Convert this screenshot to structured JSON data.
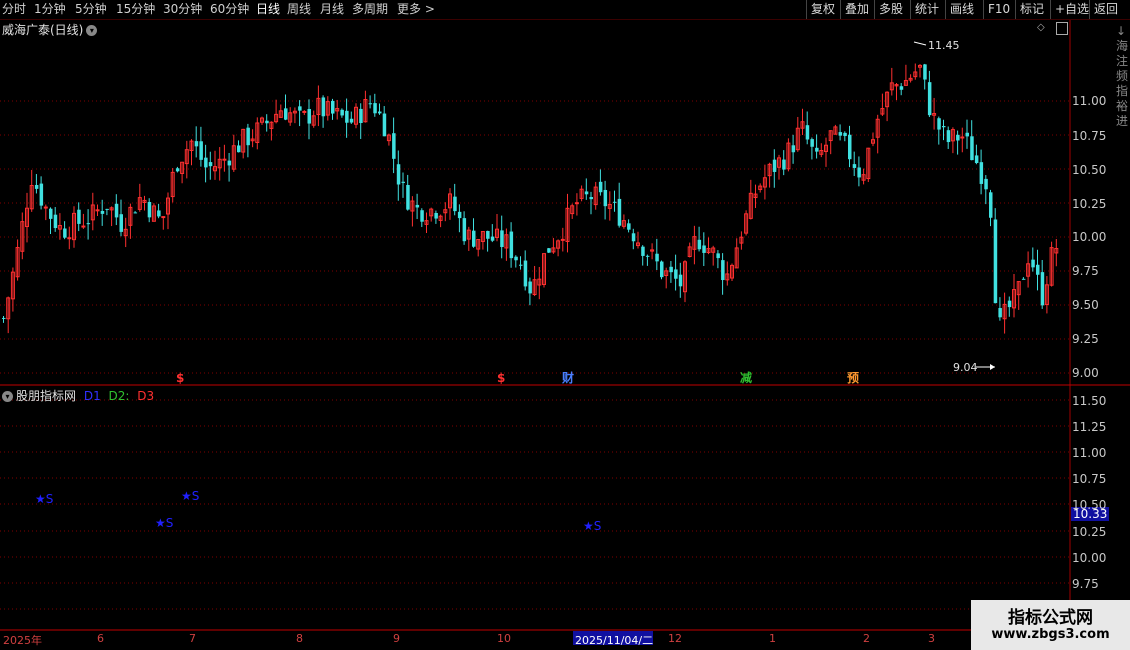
{
  "toolbar": {
    "periods": [
      "分时",
      "1分钟",
      "5分钟",
      "15分钟",
      "30分钟",
      "60分钟",
      "日线",
      "周线",
      "月线",
      "多周期",
      "更多 >"
    ],
    "active_period": "日线",
    "right_buttons": [
      "复权",
      "叠加",
      "多股",
      "统计",
      "画线",
      "F10",
      "标记",
      "+自选",
      "返回"
    ]
  },
  "chart": {
    "title": "威海广泰(日线)",
    "high_label": "11.45",
    "low_label": "9.04",
    "price_axis": [
      "11.00",
      "10.75",
      "10.50",
      "10.25",
      "10.00",
      "9.75",
      "9.50",
      "9.25",
      "9.00"
    ],
    "event_marks": [
      {
        "label": "$",
        "color": "#ff3030"
      },
      {
        "label": "$",
        "color": "#ff3030"
      },
      {
        "label": "财",
        "color": "#4a7fff"
      },
      {
        "label": "减",
        "color": "#30c030"
      },
      {
        "label": "预",
        "color": "#ff9a30"
      }
    ],
    "right_side_text": "↓ 海 注 频 指 裕 进"
  },
  "indicator": {
    "name": "股朋指标网",
    "lines": [
      {
        "label": "D1",
        "color": "#3030ff"
      },
      {
        "label": "D2:",
        "color": "#30c030"
      },
      {
        "label": "D3",
        "color": "#ff3030"
      }
    ],
    "axis": [
      "11.50",
      "11.25",
      "11.00",
      "10.75",
      "10.50",
      "10.25",
      "10.00",
      "9.75"
    ],
    "current_value": "10.33",
    "signal_label": "★S"
  },
  "xaxis": {
    "labels": [
      "2025年",
      "6",
      "7",
      "8",
      "9",
      "10",
      "12",
      "1",
      "2",
      "3"
    ],
    "cursor_date": "2025/11/04/二"
  },
  "watermark": {
    "line1": "指标公式网",
    "line2": "www.zbgs3.com"
  },
  "colors": {
    "up": "#ff3030",
    "down": "#40e0e0",
    "grid": "#800000",
    "signal": "#2020ff"
  }
}
